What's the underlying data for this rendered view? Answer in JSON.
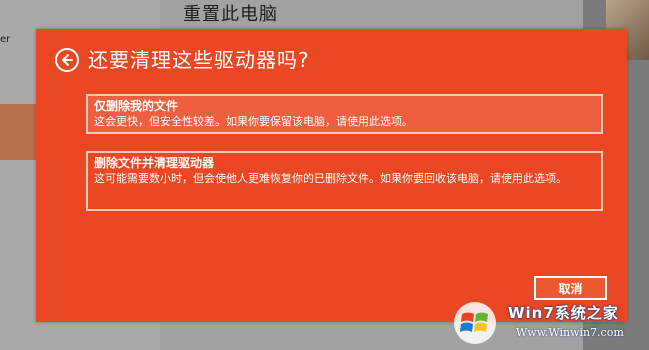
{
  "background": {
    "left_text": "er",
    "title": "重置此电脑"
  },
  "dialog": {
    "title": "还要清理这些驱动器吗?",
    "options": [
      {
        "title": "仅删除我的文件",
        "description": "这会更快，但安全性较差。如果你要保留该电脑，请使用此选项。"
      },
      {
        "title": "删除文件并清理驱动器",
        "description": "这可能需要数小时，但会使他人更难恢复你的已删除文件。如果你要回收该电脑，请使用此选项。"
      }
    ],
    "cancel_label": "取消"
  },
  "watermark": {
    "top_text": "Win7系统之家",
    "bottom_text": "Www.Winwin7.com"
  },
  "colors": {
    "dialog_bg": "#e94823",
    "option_highlight": "#ee5f3f",
    "text": "#ffffff"
  }
}
